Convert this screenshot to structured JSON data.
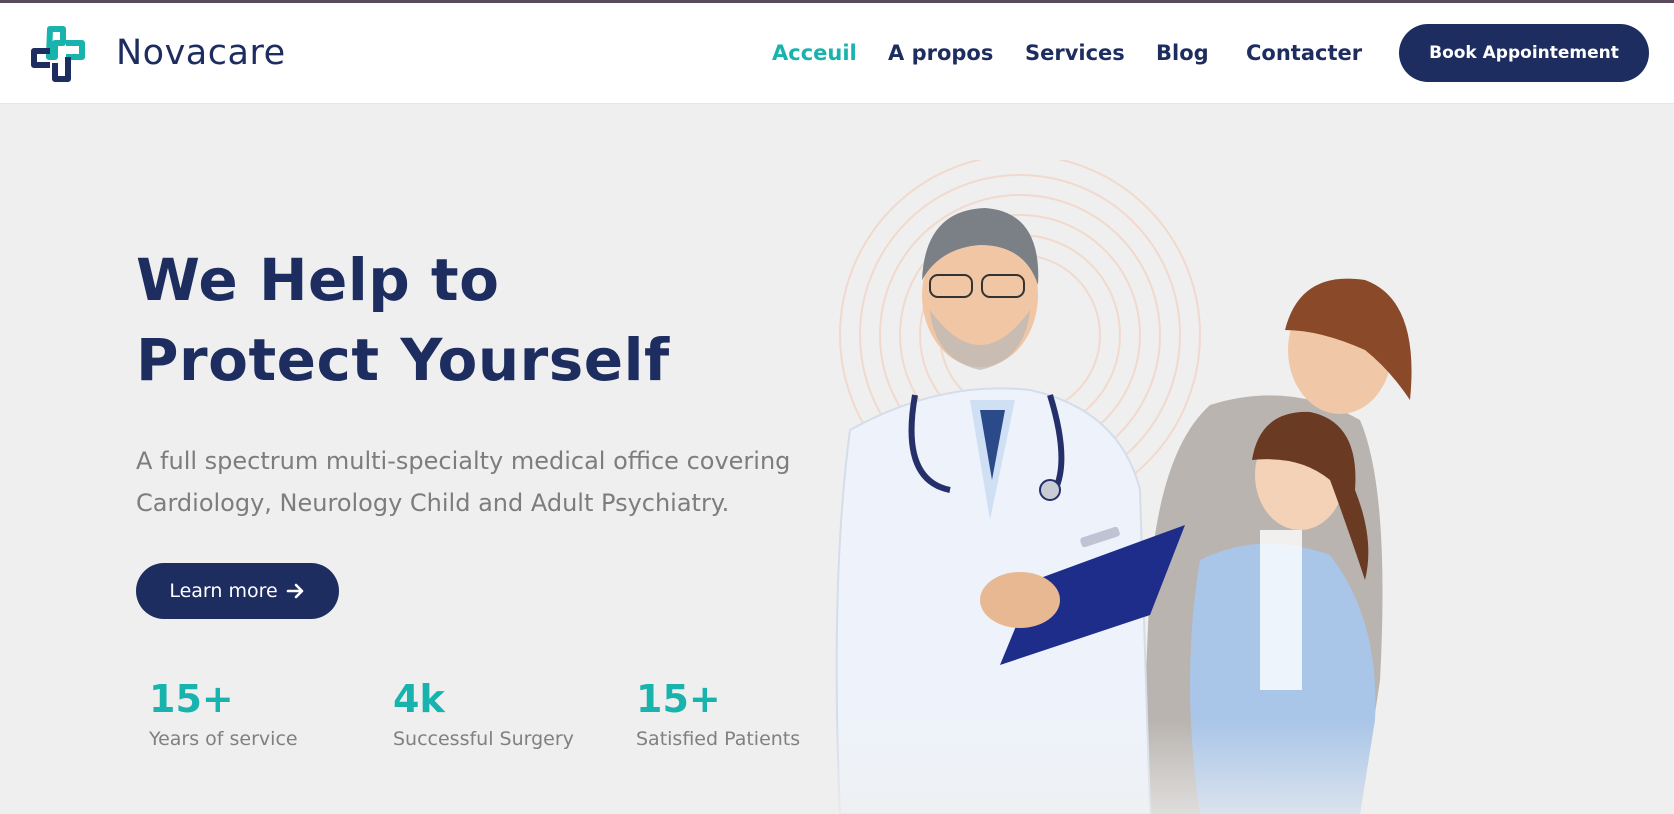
{
  "brand": {
    "name": "Novacare",
    "logo_icon": "cross-logo-icon"
  },
  "nav": {
    "items": [
      {
        "label": "Acceuil",
        "active": true
      },
      {
        "label": "A propos",
        "active": false
      },
      {
        "label": "Services",
        "active": false
      },
      {
        "label": "Blog",
        "active": false
      },
      {
        "label": "Contacter",
        "active": false
      }
    ],
    "cta_label": "Book Appointement"
  },
  "hero": {
    "title_line1": "We Help to",
    "title_line2": "Protect Yourself",
    "description": "A full spectrum multi-specialty medical office covering Cardiology, Neurology Child and Adult Psychiatry.",
    "button_label": "Learn more",
    "button_icon": "arrow-right-icon"
  },
  "stats": [
    {
      "value": "15+",
      "label": "Years of service"
    },
    {
      "value": "4k",
      "label": "Successful Surgery"
    },
    {
      "value": "15+",
      "label": "Satisfied Patients"
    }
  ],
  "colors": {
    "primary": "#1e2d5f",
    "accent": "#19b3ad",
    "background": "#efefef",
    "ring": "#f3c9b8"
  }
}
